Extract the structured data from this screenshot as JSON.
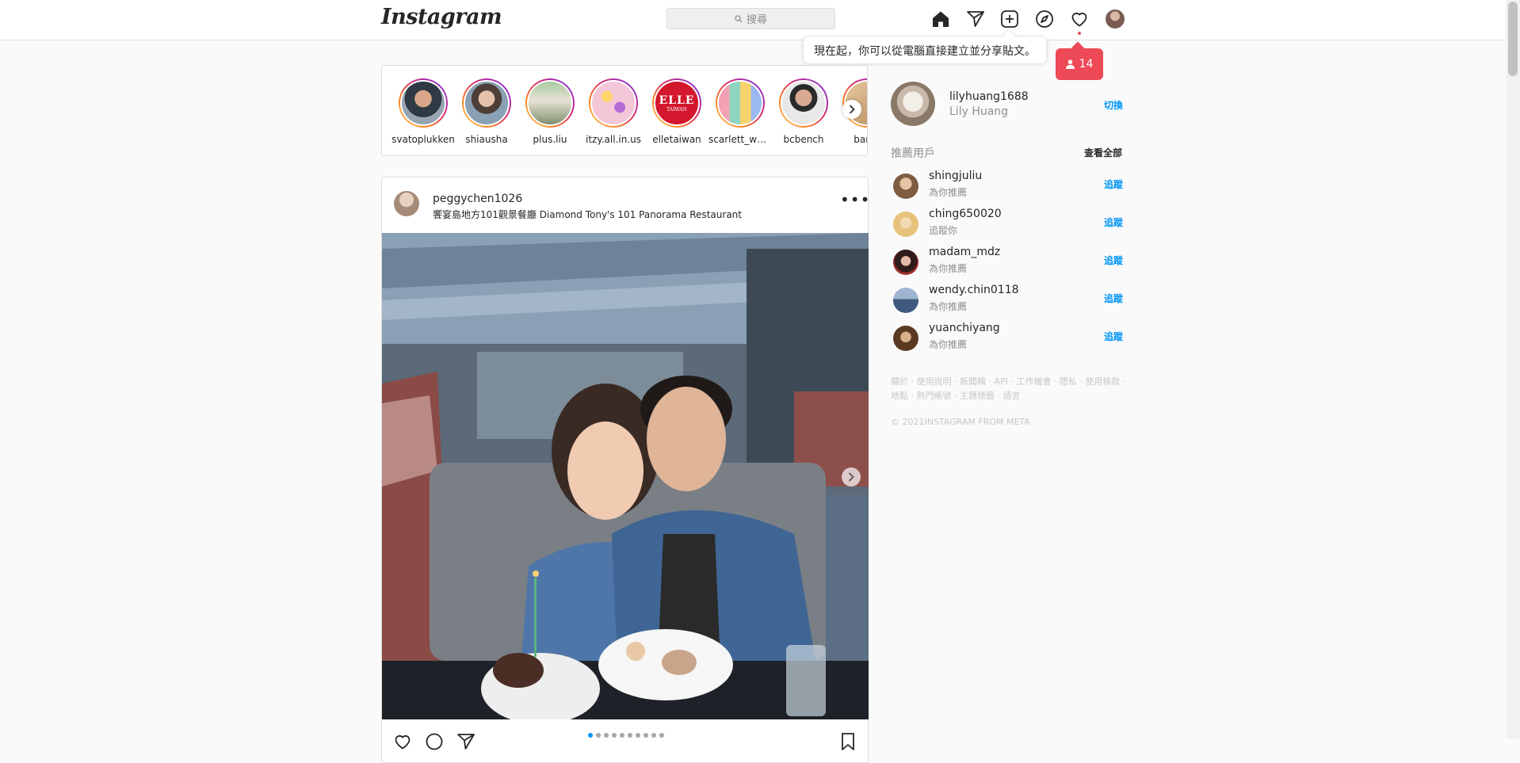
{
  "nav": {
    "logo": "Instagram",
    "search_placeholder": "搜尋"
  },
  "tooltip": {
    "text": "現在起，你可以從電腦直接建立並分享貼文。"
  },
  "activity": {
    "count": "14"
  },
  "stories": [
    {
      "name": "svatoplukken"
    },
    {
      "name": "shiausha"
    },
    {
      "name": "plus.liu"
    },
    {
      "name": "itzy.all.in.us"
    },
    {
      "name": "elletaiwan",
      "logo_text": "ELLE",
      "logo_sub": "TAIWAN"
    },
    {
      "name": "scarlett_whi..."
    },
    {
      "name": "bcbench"
    },
    {
      "name": "bangl"
    }
  ],
  "post": {
    "username": "peggychen1026",
    "location": "饗宴島地方101觀景餐廳 Diamond Tony's 101 Panorama Restaurant",
    "more": "•••",
    "carousel_total": 10,
    "carousel_index": 1
  },
  "profile": {
    "username": "lilyhuang1688",
    "name": "Lily Huang",
    "switch": "切換"
  },
  "suggestions": {
    "title": "推薦用戶",
    "see_all": "查看全部",
    "items": [
      {
        "username": "shingjuliu",
        "sub": "為你推薦",
        "follow": "追蹤"
      },
      {
        "username": "ching650020",
        "sub": "追蹤你",
        "follow": "追蹤"
      },
      {
        "username": "madam_mdz",
        "sub": "為你推薦",
        "follow": "追蹤"
      },
      {
        "username": "wendy.chin0118",
        "sub": "為你推薦",
        "follow": "追蹤"
      },
      {
        "username": "yuanchiyang",
        "sub": "為你推薦",
        "follow": "追蹤"
      }
    ]
  },
  "footer": {
    "links_line1": "關於 · 使用說明 · 新聞稿 · API · 工作機會 · 隱私 · 使用條款 ·",
    "links_line2": "地點 · 熱門帳號 · 主題標籤 · 語言",
    "copyright": "© 2021INSTAGRAM FROM META"
  },
  "colors": {
    "accent": "#0095f6",
    "notification": "#ed4956",
    "border": "#dbdbdb"
  }
}
